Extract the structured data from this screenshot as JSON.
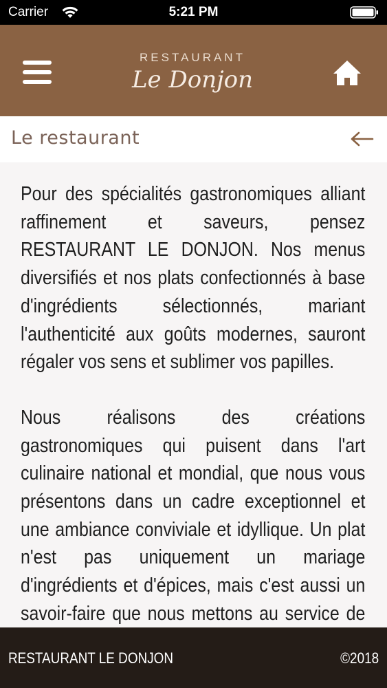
{
  "status_bar": {
    "carrier": "Carrier",
    "time": "5:21 PM",
    "wifi_icon": "wifi-icon",
    "battery_icon": "battery-icon"
  },
  "header": {
    "background_color": "#8a6243",
    "menu_icon": "hamburger-icon",
    "logo_top": "RESTAURANT",
    "logo_script": "Le Donjon",
    "home_icon": "home-icon"
  },
  "page": {
    "title": "Le restaurant",
    "back_icon": "arrow-left-icon"
  },
  "content": {
    "paragraphs": [
      "Pour des spécialités gastronomiques alliant raffinement et saveurs, pensez RESTAURANT LE DONJON. Nos menus diversifiés et nos plats confectionnés à base d'ingrédients sélectionnés, mariant l'authenticité aux goûts modernes, sauront régaler vos sens et sublimer vos papilles.",
      "Nous réalisons des créations gastronomiques qui puisent dans l'art culinaire national et mondial, que nous vous présentons dans un cadre exceptionnel et une ambiance conviviale et idyllique. Un plat n'est pas uniquement un mariage d'ingrédients et d'épices, mais c'est aussi un savoir-faire que nous mettons au service de vos désirs."
    ]
  },
  "footer": {
    "background_color": "#241c17",
    "brand": "RESTAURANT LE DONJON",
    "copyright": "©2018"
  }
}
